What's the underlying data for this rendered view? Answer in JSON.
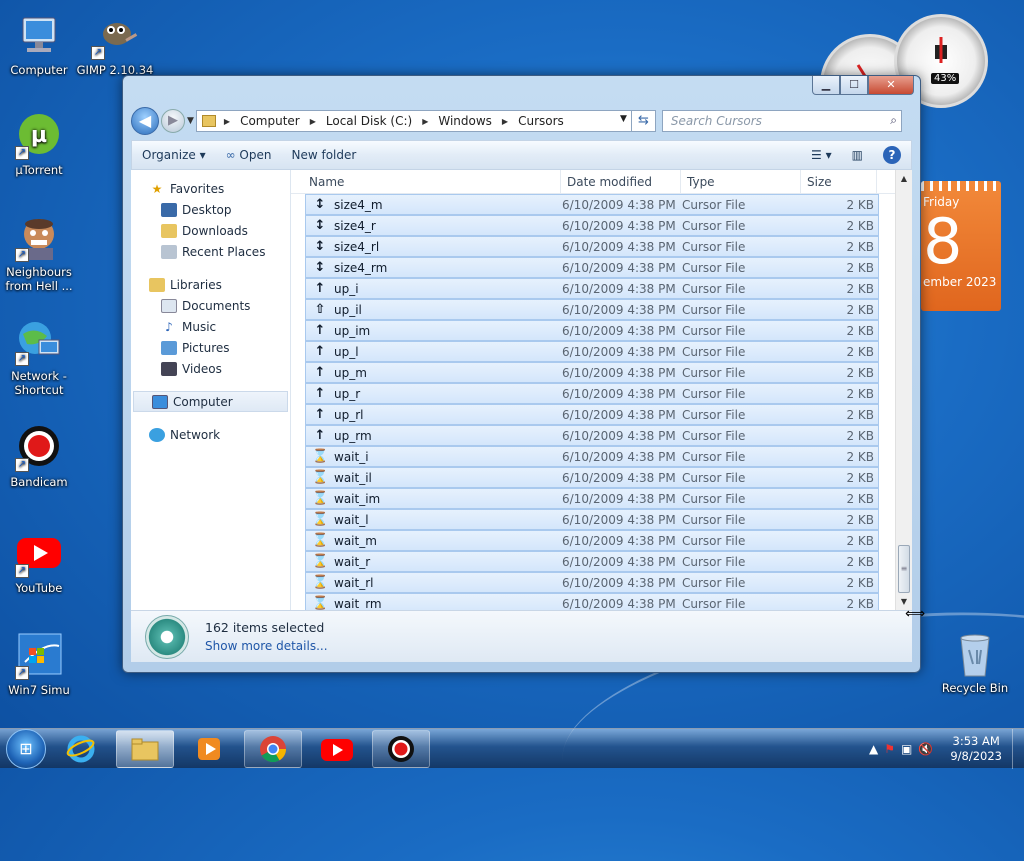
{
  "desktop": {
    "icons": [
      {
        "label": "Computer",
        "icon": "computer-icon"
      },
      {
        "label": "GIMP 2.10.34",
        "icon": "gimp-icon"
      },
      {
        "label": "µTorrent",
        "icon": "utorrent-icon"
      },
      {
        "label": "Neighbours from Hell ...",
        "icon": "game-icon"
      },
      {
        "label": "Network - Shortcut",
        "icon": "network-icon"
      },
      {
        "label": "Bandicam",
        "icon": "bandicam-icon"
      },
      {
        "label": "YouTube",
        "icon": "youtube-icon"
      },
      {
        "label": "Win7 Simu",
        "icon": "win7-icon"
      },
      {
        "label": "Recycle Bin",
        "icon": "recycle-bin-icon"
      }
    ],
    "gadgets": {
      "cpu_gauge": "43%",
      "calendar": {
        "day": "Friday",
        "date": "8",
        "month": "ember 2023"
      }
    }
  },
  "explorer": {
    "caption_buttons": {
      "minimize": "▁",
      "maximize": "☐",
      "close": "✕"
    },
    "address": {
      "crumbs": [
        "Computer",
        "Local Disk (C:)",
        "Windows",
        "Cursors"
      ]
    },
    "search": {
      "placeholder": "Search Cursors"
    },
    "toolbar": {
      "organize": "Organize ▾",
      "open": "Open",
      "new_folder": "New folder",
      "help": "?"
    },
    "nav": {
      "favorites": "Favorites",
      "desktop": "Desktop",
      "downloads": "Downloads",
      "recent": "Recent Places",
      "libraries": "Libraries",
      "documents": "Documents",
      "music": "Music",
      "pictures": "Pictures",
      "videos": "Videos",
      "computer": "Computer",
      "network": "Network"
    },
    "columns": {
      "name": "Name",
      "date": "Date modified",
      "type": "Type",
      "size": "Size"
    },
    "files": [
      {
        "name": "size4_m",
        "date": "6/10/2009 4:38 PM",
        "type": "Cursor File",
        "size": "2 KB",
        "glyph": "↕"
      },
      {
        "name": "size4_r",
        "date": "6/10/2009 4:38 PM",
        "type": "Cursor File",
        "size": "2 KB",
        "glyph": "↕"
      },
      {
        "name": "size4_rl",
        "date": "6/10/2009 4:38 PM",
        "type": "Cursor File",
        "size": "2 KB",
        "glyph": "↕"
      },
      {
        "name": "size4_rm",
        "date": "6/10/2009 4:38 PM",
        "type": "Cursor File",
        "size": "2 KB",
        "glyph": "↕"
      },
      {
        "name": "up_i",
        "date": "6/10/2009 4:38 PM",
        "type": "Cursor File",
        "size": "2 KB",
        "glyph": "↑"
      },
      {
        "name": "up_il",
        "date": "6/10/2009 4:38 PM",
        "type": "Cursor File",
        "size": "2 KB",
        "glyph": "⇧"
      },
      {
        "name": "up_im",
        "date": "6/10/2009 4:38 PM",
        "type": "Cursor File",
        "size": "2 KB",
        "glyph": "↑"
      },
      {
        "name": "up_l",
        "date": "6/10/2009 4:38 PM",
        "type": "Cursor File",
        "size": "2 KB",
        "glyph": "↑"
      },
      {
        "name": "up_m",
        "date": "6/10/2009 4:38 PM",
        "type": "Cursor File",
        "size": "2 KB",
        "glyph": "↑"
      },
      {
        "name": "up_r",
        "date": "6/10/2009 4:38 PM",
        "type": "Cursor File",
        "size": "2 KB",
        "glyph": "↑"
      },
      {
        "name": "up_rl",
        "date": "6/10/2009 4:38 PM",
        "type": "Cursor File",
        "size": "2 KB",
        "glyph": "↑"
      },
      {
        "name": "up_rm",
        "date": "6/10/2009 4:38 PM",
        "type": "Cursor File",
        "size": "2 KB",
        "glyph": "↑"
      },
      {
        "name": "wait_i",
        "date": "6/10/2009 4:38 PM",
        "type": "Cursor File",
        "size": "2 KB",
        "glyph": "⌛"
      },
      {
        "name": "wait_il",
        "date": "6/10/2009 4:38 PM",
        "type": "Cursor File",
        "size": "2 KB",
        "glyph": "⌛"
      },
      {
        "name": "wait_im",
        "date": "6/10/2009 4:38 PM",
        "type": "Cursor File",
        "size": "2 KB",
        "glyph": "⌛"
      },
      {
        "name": "wait_l",
        "date": "6/10/2009 4:38 PM",
        "type": "Cursor File",
        "size": "2 KB",
        "glyph": "⌛"
      },
      {
        "name": "wait_m",
        "date": "6/10/2009 4:38 PM",
        "type": "Cursor File",
        "size": "2 KB",
        "glyph": "⌛"
      },
      {
        "name": "wait_r",
        "date": "6/10/2009 4:38 PM",
        "type": "Cursor File",
        "size": "2 KB",
        "glyph": "⌛"
      },
      {
        "name": "wait_rl",
        "date": "6/10/2009 4:38 PM",
        "type": "Cursor File",
        "size": "2 KB",
        "glyph": "⌛"
      },
      {
        "name": "wait_rm",
        "date": "6/10/2009 4:38 PM",
        "type": "Cursor File",
        "size": "2 KB",
        "glyph": "⌛"
      }
    ],
    "details": {
      "count": "162 items selected",
      "more": "Show more details..."
    }
  },
  "taskbar": {
    "apps": [
      "windows-explorer",
      "internet-explorer",
      "media-player",
      "chrome",
      "youtube",
      "bandicam"
    ],
    "clock": {
      "time": "3:53 AM",
      "date": "9/8/2023"
    }
  },
  "colors": {
    "selection": "#d4e6fb",
    "selection_border": "#a9c9ee",
    "link": "#1f56a8"
  }
}
